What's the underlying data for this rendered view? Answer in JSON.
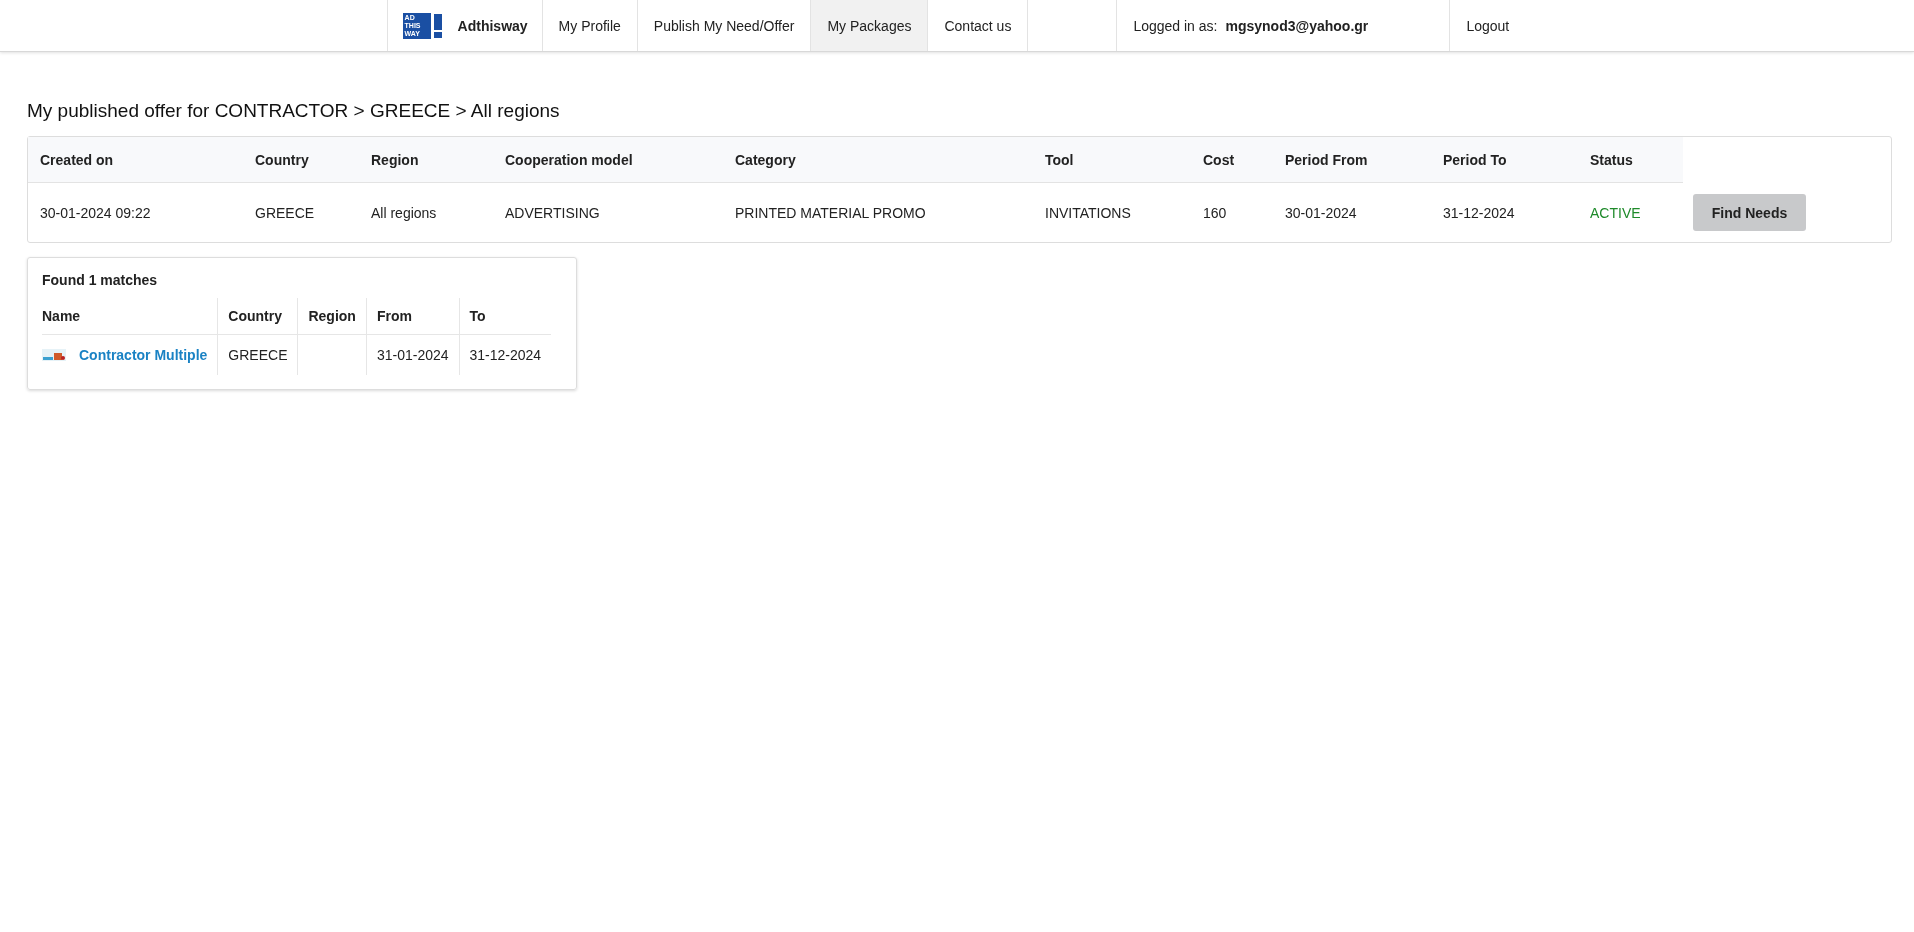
{
  "nav": {
    "logo_lines": [
      "AD",
      "THIS",
      "WAY"
    ],
    "brand": "Adthisway",
    "items": [
      {
        "label": "My Profile",
        "selected": false
      },
      {
        "label": "Publish My Need/Offer",
        "selected": false
      },
      {
        "label": "My Packages",
        "selected": true
      },
      {
        "label": "Contact us",
        "selected": false
      }
    ],
    "logged_in_label": "Logged in as:",
    "user_email": "mgsynod3@yahoo.gr",
    "logout": "Logout"
  },
  "heading": "My published offer for CONTRACTOR > GREECE > All regions",
  "offer_table": {
    "columns": [
      "Created on",
      "Country",
      "Region",
      "Cooperation model",
      "Category",
      "Tool",
      "Cost",
      "Period From",
      "Period To",
      "Status"
    ],
    "rows": [
      {
        "cells": [
          "30-01-2024 09:22",
          "GREECE",
          "All regions",
          "ADVERTISING",
          "PRINTED MATERIAL PROMO",
          "INVITATIONS",
          "160",
          "30-01-2024",
          "31-12-2024",
          "ACTIVE"
        ],
        "action": "Find Needs"
      }
    ]
  },
  "matches": {
    "title": "Found 1 matches",
    "columns": [
      "Name",
      "Country",
      "Region",
      "From",
      "To"
    ],
    "rows": [
      {
        "cells": [
          "Contractor Multiple",
          "GREECE",
          "",
          "31-01-2024",
          "31-12-2024"
        ]
      }
    ]
  }
}
